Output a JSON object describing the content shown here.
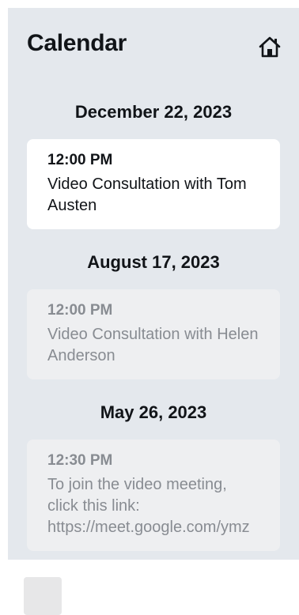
{
  "header": {
    "title": "Calendar",
    "home_icon": "home-icon"
  },
  "events": [
    {
      "date": "December 22, 2023",
      "time": "12:00 PM",
      "text": "Video Consultation with Tom Austen",
      "state": "upcoming"
    },
    {
      "date": "August 17, 2023",
      "time": "12:00 PM",
      "text": "Video Consultation with Helen Anderson",
      "state": "past"
    },
    {
      "date": "May 26, 2023",
      "time": "12:30 PM",
      "text": "To join the video meeting, click this link: https://meet.google.com/ymz",
      "state": "past"
    }
  ],
  "colors": {
    "panel_background": "#e4e8ed",
    "active_card": "#ffffff",
    "past_card": "#eeeff1",
    "past_text": "#888c92",
    "text": "#111418"
  }
}
